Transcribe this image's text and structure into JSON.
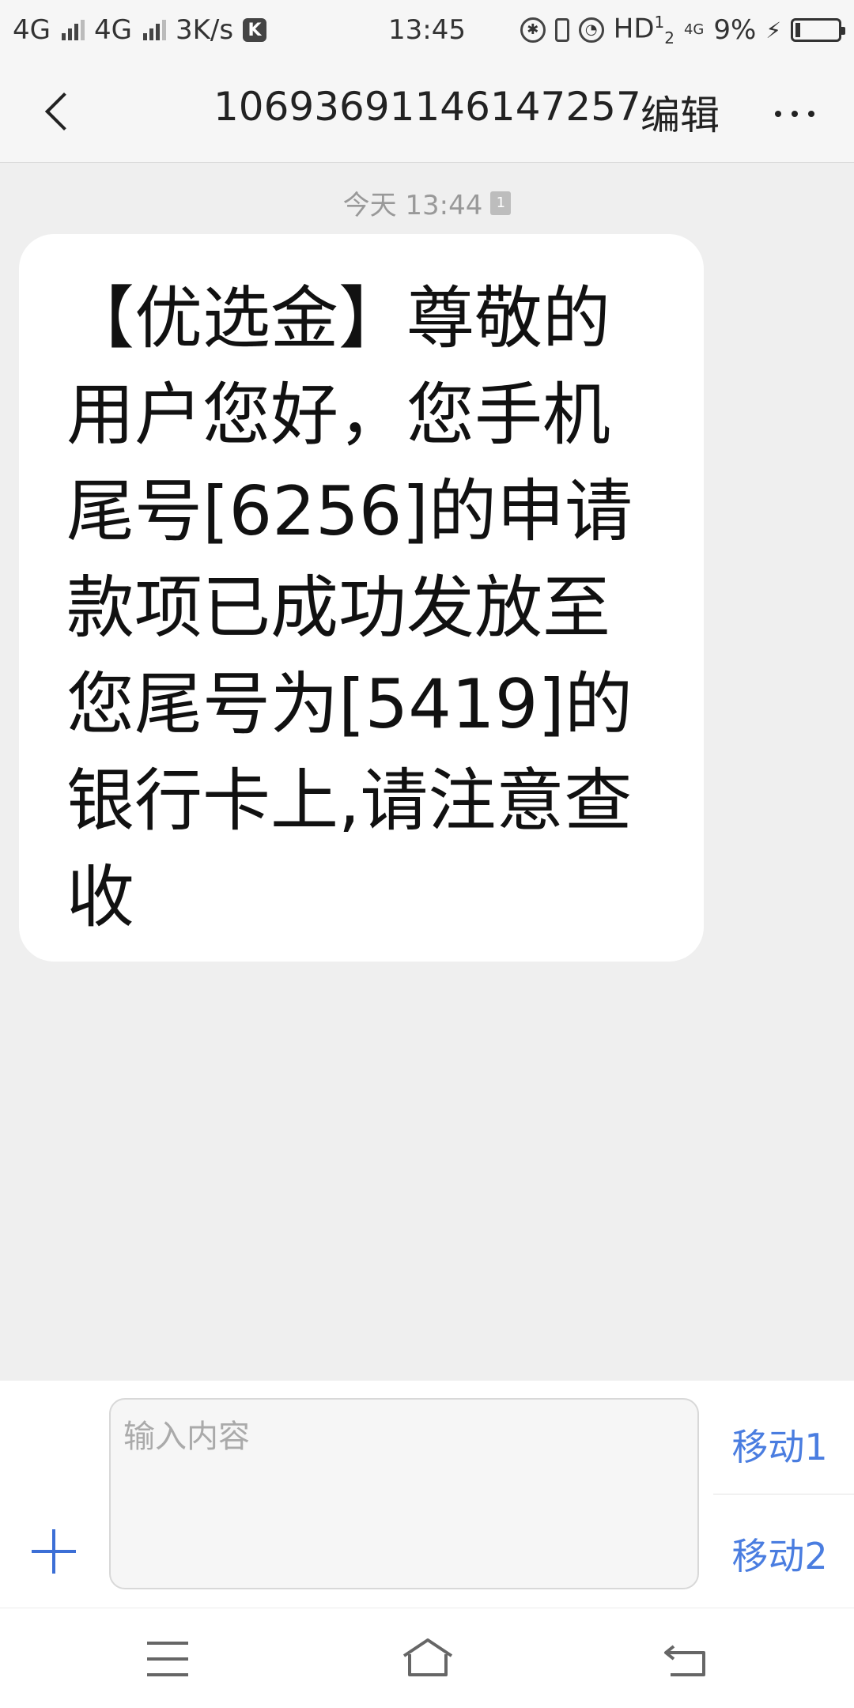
{
  "status_bar": {
    "sim1_network": "4G",
    "sim2_network": "4G",
    "net_speed": "3K/s",
    "app_badge": "K",
    "time": "13:45",
    "hd_label": "HD",
    "hd_sub": "1",
    "hd_sub2": "2",
    "data_4g": "4G",
    "battery": "9%"
  },
  "header": {
    "title": "10693691146147257",
    "edit_label": "编辑"
  },
  "conversation": {
    "timestamp": "今天 13:44",
    "sim_badge": "1",
    "messages": [
      {
        "text": "【优选金】尊敬的用户您好，您手机尾号[6256]的申请款项已成功发放至您尾号为[5419]的银行卡上,请注意查收"
      }
    ]
  },
  "composer": {
    "placeholder": "输入内容",
    "send_sim1_label": "移动1",
    "send_sim2_label": "移动2"
  },
  "icons": {
    "back": "back-arrow-icon",
    "more": "more-dots-icon",
    "add": "plus-icon",
    "nav_menu": "menu-icon",
    "nav_home": "home-icon",
    "nav_back": "return-icon"
  },
  "colors": {
    "accent": "#4a7de0",
    "background": "#efefef",
    "bubble": "#ffffff"
  }
}
